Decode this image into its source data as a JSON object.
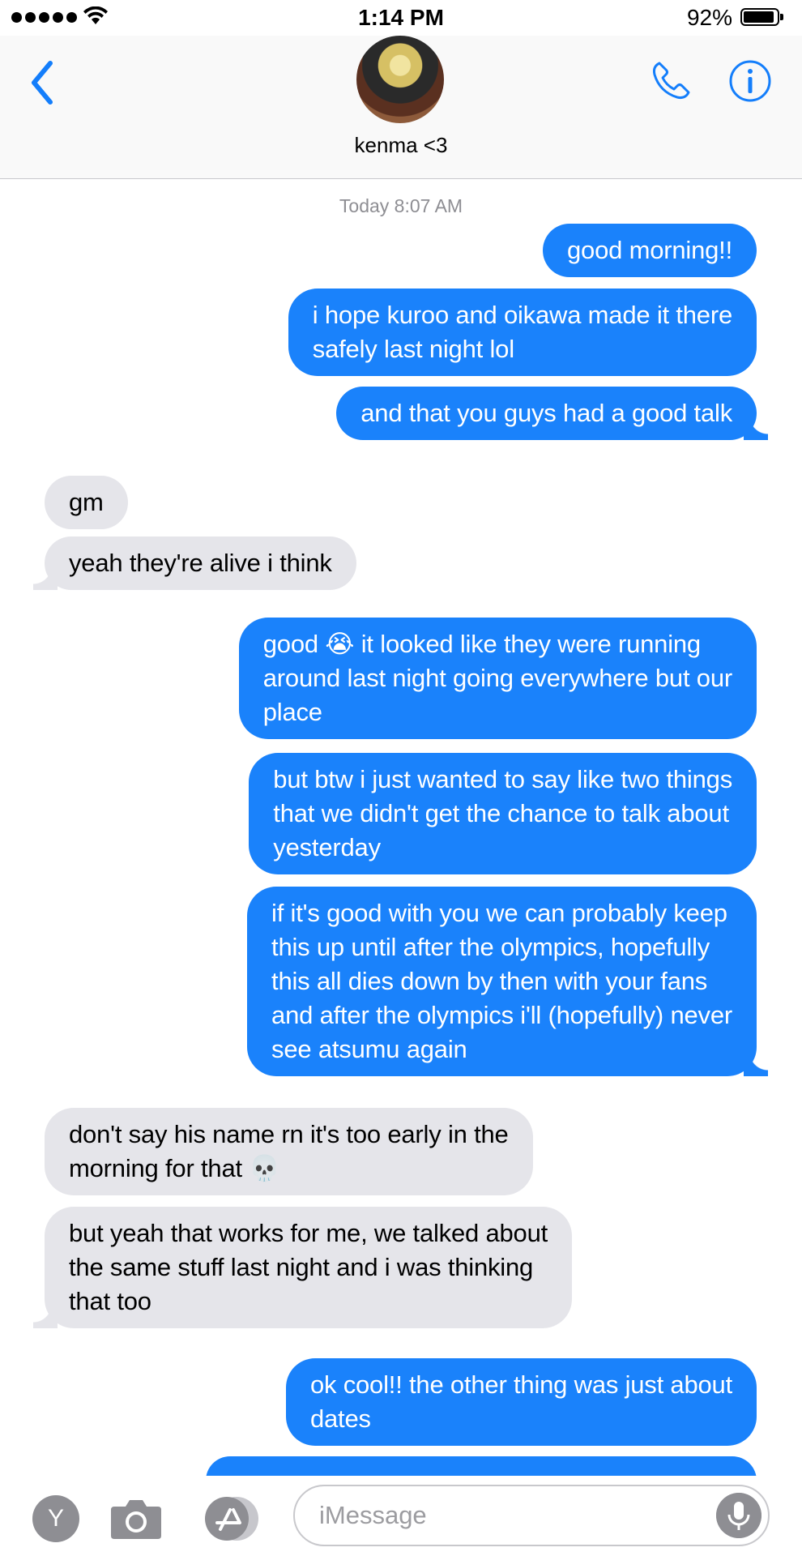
{
  "status_bar": {
    "time": "1:14 PM",
    "battery_percent": "92%",
    "battery_level": 0.92,
    "signal_bars": 5
  },
  "header": {
    "contact_name": "kenma <3",
    "back_icon": "chevron-left-icon",
    "call_icon": "phone-icon",
    "info_icon": "info-icon"
  },
  "thread": {
    "timestamp": "Today 8:07 AM",
    "messages": [
      {
        "from": "me",
        "text": "good morning!!"
      },
      {
        "from": "me",
        "text": "i hope kuroo and oikawa made it there\nsafely last night lol"
      },
      {
        "from": "me",
        "text": "and that you guys had a good talk"
      },
      {
        "from": "them",
        "text": "gm"
      },
      {
        "from": "them",
        "text": "yeah they're alive i think"
      },
      {
        "from": "me",
        "text": "good 😭 it looked like they were running\naround last night going everywhere but our\nplace"
      },
      {
        "from": "me",
        "text": "but btw i just wanted to say like two things\nthat we didn't get the chance to talk about\nyesterday"
      },
      {
        "from": "me",
        "text": "if it's good with you we can probably keep\nthis up until after the olympics, hopefully\nthis all dies down by then with your fans\nand after the olympics i'll  (hopefully) never\nsee atsumu again"
      },
      {
        "from": "them",
        "text": "don't say his name rn it's too early in the\nmorning for that 💀"
      },
      {
        "from": "them",
        "text": "but yeah that works for me, we talked about\nthe same stuff last night and i was thinking\nthat too"
      },
      {
        "from": "me",
        "text": "ok cool!! the other thing was just about\ndates"
      }
    ]
  },
  "input_bar": {
    "y_button": "Y",
    "placeholder": "iMessage",
    "camera_icon": "camera-icon",
    "apps_icon": "app-store-icon",
    "mic_icon": "microphone-icon"
  },
  "colors": {
    "outgoing": "#1a82fb",
    "incoming": "#e5e5ea",
    "accent": "#147efb"
  }
}
